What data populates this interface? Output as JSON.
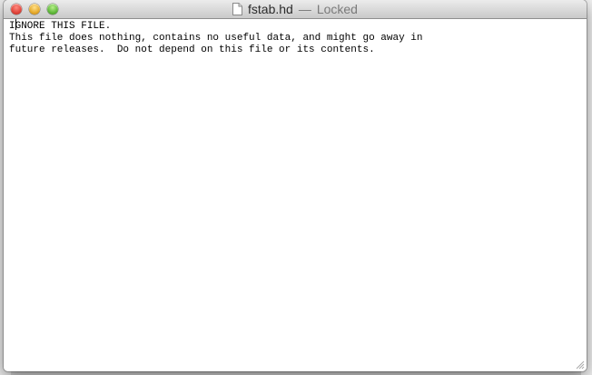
{
  "window": {
    "file_name": "fstab.hd",
    "separator": "—",
    "status": "Locked"
  },
  "editor": {
    "first_char": "I",
    "line1_rest": "GNORE THIS FILE.",
    "line2": "This file does nothing, contains no useful data, and might go away in",
    "line3": "future releases.  Do not depend on this file or its contents."
  },
  "icons": {
    "document": "document-icon",
    "close": "close-icon",
    "minimize": "minimize-icon",
    "zoom": "zoom-icon",
    "resize": "resize-grip-icon"
  },
  "colors": {
    "close": "#e0443a",
    "minimize": "#e5a92a",
    "zoom": "#5fb83a"
  }
}
